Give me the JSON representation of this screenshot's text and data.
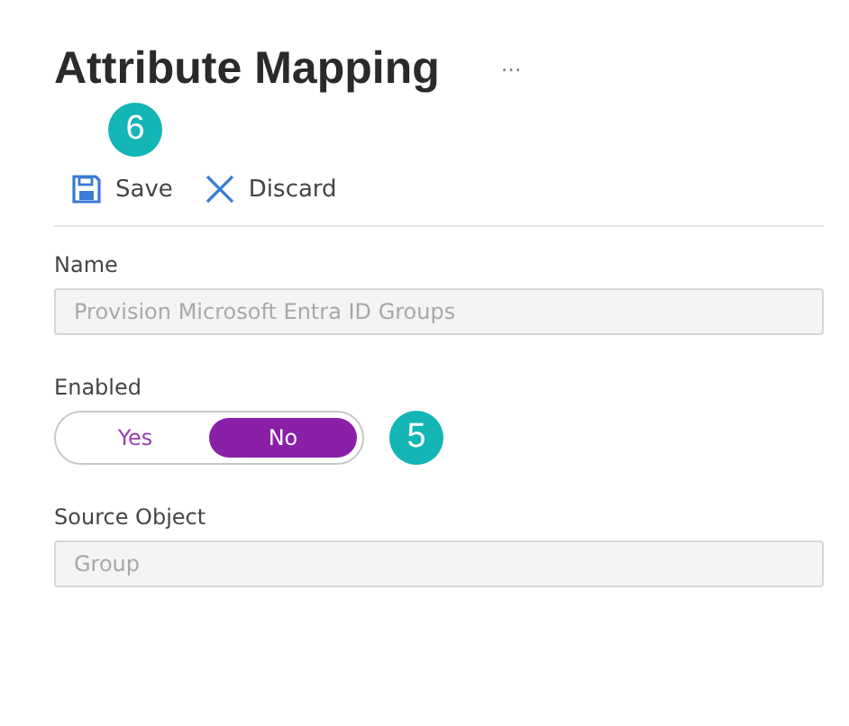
{
  "title": "Attribute Mapping",
  "more": "···",
  "toolbar": [
    {
      "kind": "save",
      "label": "Save",
      "callout": "6"
    },
    {
      "kind": "discard",
      "label": "Discard"
    }
  ],
  "fields": [
    {
      "kind": "text",
      "label": "Name",
      "value": "Provision Microsoft Entra ID Groups",
      "disabled": true
    },
    {
      "kind": "toggle",
      "label": "Enabled",
      "callout": "5",
      "options": [
        {
          "label": "Yes",
          "selected": false
        },
        {
          "label": "No",
          "selected": true
        }
      ]
    },
    {
      "kind": "text",
      "label": "Source Object",
      "value": "Group",
      "disabled": true
    }
  ]
}
